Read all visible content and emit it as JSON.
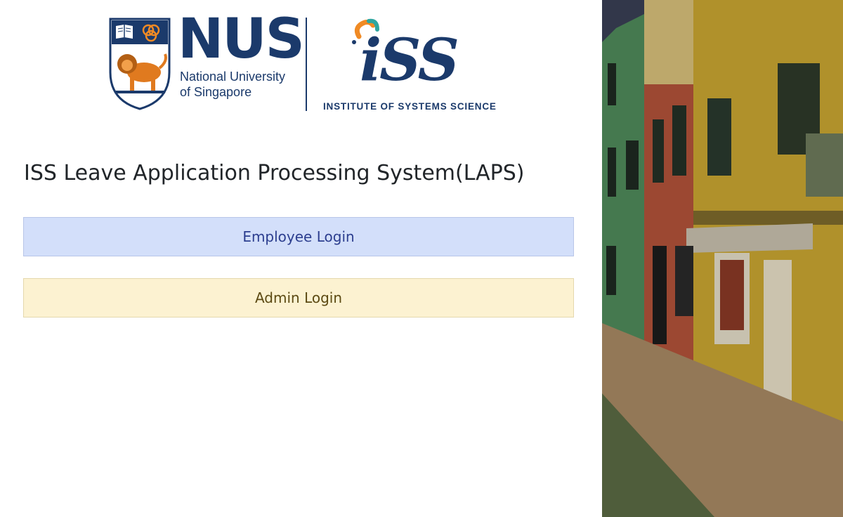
{
  "logos": {
    "nus": {
      "wordmark": "NUS",
      "subtitle_line1": "National University",
      "subtitle_line2": "of Singapore"
    },
    "iss": {
      "wordmark": "iSS",
      "tagline": "INSTITUTE OF SYSTEMS SCIENCE"
    }
  },
  "page": {
    "title": "ISS Leave Application Processing System(LAPS)"
  },
  "buttons": {
    "employee_login": "Employee Login",
    "admin_login": "Admin Login"
  },
  "colors": {
    "brand_navy": "#1b3a6b",
    "employee_button_bg": "#d3dffa",
    "admin_button_bg": "#fcf2d1"
  },
  "hero_image": {
    "icon": "colorful-street-photo"
  }
}
